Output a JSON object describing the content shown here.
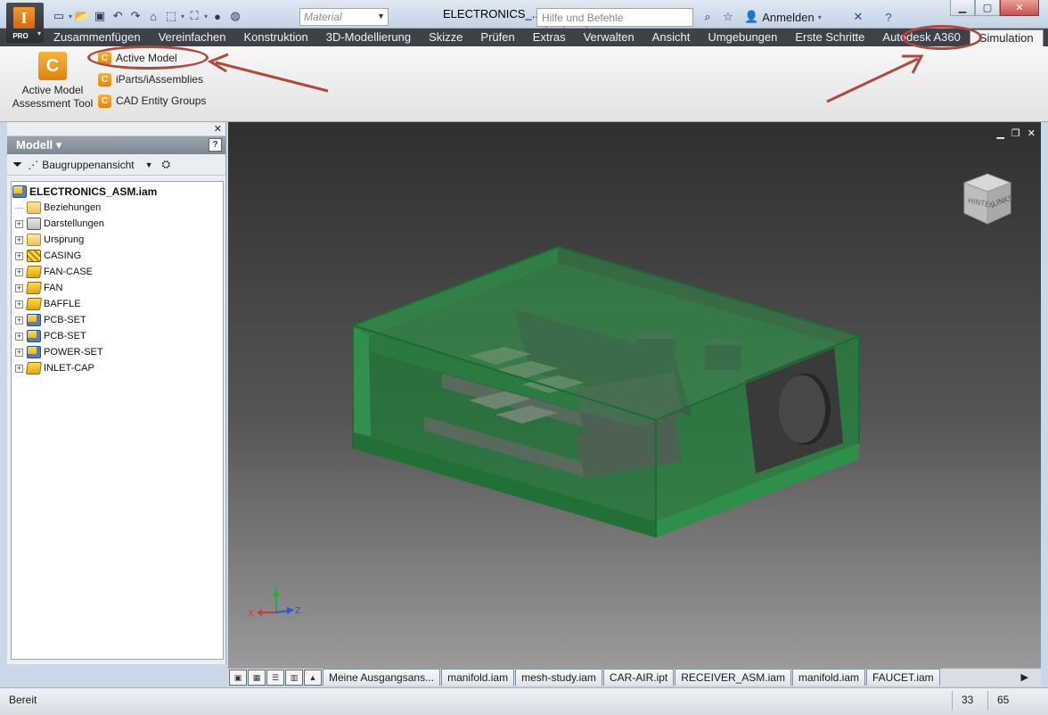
{
  "app": {
    "badge": "PRO",
    "window_title": "ELECTRONICS_...",
    "material_placeholder": "Material",
    "search_placeholder": "Hilfe und Befehle durchsuchen..",
    "sign_in": "Anmelden"
  },
  "menu_tabs": [
    "Zusammenfügen",
    "Vereinfachen",
    "Konstruktion",
    "3D-Modellierung",
    "Skizze",
    "Prüfen",
    "Extras",
    "Verwalten",
    "Ansicht",
    "Umgebungen",
    "Erste Schritte",
    "Autodesk A360",
    "Simulation"
  ],
  "ribbon": {
    "big_button": "Active Model Assessment Tool",
    "items": [
      "Active Model",
      "iParts/iAssemblies",
      "CAD Entity Groups"
    ]
  },
  "panel": {
    "title": "Modell",
    "view_select": "Baugruppenansicht",
    "tree": [
      {
        "label": "ELECTRONICS_ASM.iam",
        "icon": "assembly-icon",
        "root": true
      },
      {
        "label": "Beziehungen",
        "icon": "folder-icon",
        "expandable": false
      },
      {
        "label": "Darstellungen",
        "icon": "representations-icon",
        "expandable": true
      },
      {
        "label": "Ursprung",
        "icon": "folder-icon",
        "expandable": true
      },
      {
        "label": "CASING",
        "icon": "hatched-part-icon",
        "expandable": true
      },
      {
        "label": "FAN-CASE",
        "icon": "part-icon",
        "expandable": true
      },
      {
        "label": "FAN",
        "icon": "part-icon",
        "expandable": true
      },
      {
        "label": "BAFFLE",
        "icon": "part-icon",
        "expandable": true
      },
      {
        "label": "PCB-SET",
        "icon": "assembly-icon",
        "expandable": true
      },
      {
        "label": "PCB-SET",
        "icon": "assembly-icon",
        "expandable": true
      },
      {
        "label": "POWER-SET",
        "icon": "assembly-icon",
        "expandable": true
      },
      {
        "label": "INLET-CAP",
        "icon": "part-icon",
        "expandable": true
      }
    ]
  },
  "viewcube": {
    "faces": [
      "HINTEN",
      "LINKS"
    ]
  },
  "axes": {
    "x": "X",
    "y": "Y",
    "z": "Z"
  },
  "doc_tabs": [
    "Meine Ausgangsans...",
    "manifold.iam",
    "mesh-study.iam",
    "CAR-AIR.ipt",
    "RECEIVER_ASM.iam",
    "manifold.iam",
    "FAUCET.iam"
  ],
  "status": {
    "text": "Bereit",
    "count_a": "33",
    "count_b": "65"
  },
  "colors": {
    "annotation": "#b2473e",
    "model_green": "#2f9a4d",
    "menu_bar": "#3e4248"
  }
}
